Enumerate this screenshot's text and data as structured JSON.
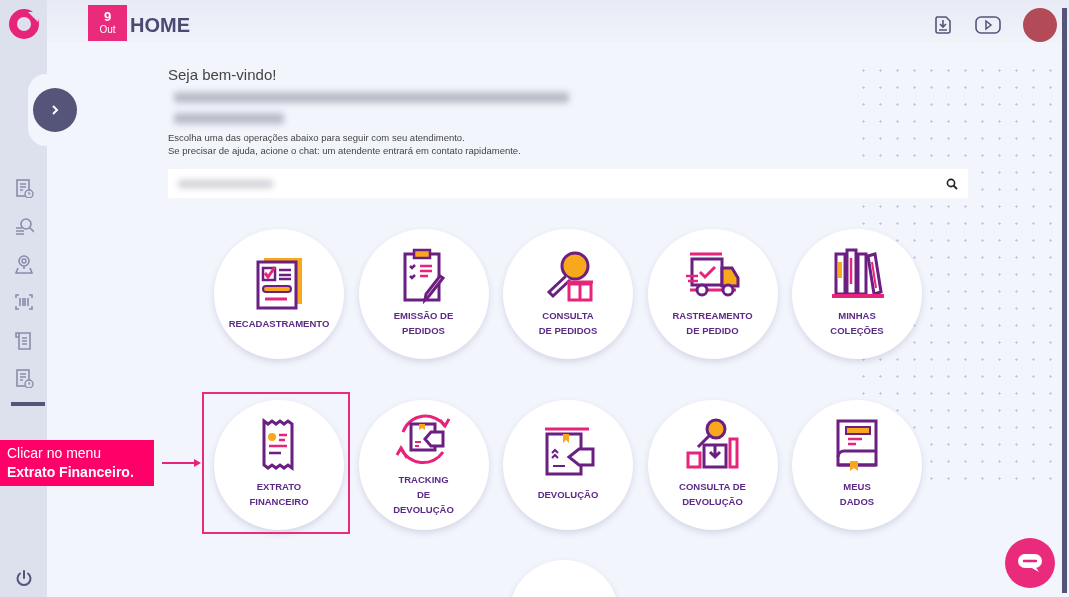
{
  "header": {
    "date": {
      "day": "9",
      "month": "Out"
    },
    "title": "HOME"
  },
  "sidebar": {
    "items": [
      {
        "kind": "report"
      },
      {
        "kind": "search"
      },
      {
        "kind": "location"
      },
      {
        "kind": "barcode"
      },
      {
        "kind": "scroll"
      },
      {
        "kind": "report"
      }
    ]
  },
  "welcome": {
    "greeting": "Seja bem-vindo!",
    "instructions": [
      "Escolha uma das operações abaixo para seguir com seu atendimento.",
      "Se precisar de ajuda, acione o chat: um atendente entrará em contato rapidamente."
    ]
  },
  "tiles": [
    {
      "kind": "recadastramento",
      "label": "RECADASTRAMENTO",
      "highlighted": false
    },
    {
      "kind": "emissao",
      "label": "EMISSÃO DE\nPEDIDOS",
      "highlighted": false
    },
    {
      "kind": "consulta",
      "label": "CONSULTA\nDE PEDIDOS",
      "highlighted": false
    },
    {
      "kind": "rastreamento",
      "label": "RASTREAMENTO\nDE PEDIDO",
      "highlighted": false
    },
    {
      "kind": "colecoes",
      "label": "MINHAS\nCOLEÇÕES",
      "highlighted": false
    },
    {
      "kind": "extrato",
      "label": "EXTRATO\nFINANCEIRO",
      "highlighted": true
    },
    {
      "kind": "tracking",
      "label": "TRACKING\nDE\nDEVOLUÇÃO",
      "highlighted": false
    },
    {
      "kind": "devolucao",
      "label": "DEVOLUÇÃO",
      "highlighted": false
    },
    {
      "kind": "consulta_devolucao",
      "label": "CONSULTA DE\nDEVOLUÇÃO",
      "highlighted": false
    },
    {
      "kind": "dados",
      "label": "MEUS\nDADOS",
      "highlighted": false
    }
  ],
  "annotation": {
    "text": "Clicar no menu\n**Extrato Financeiro.**"
  }
}
